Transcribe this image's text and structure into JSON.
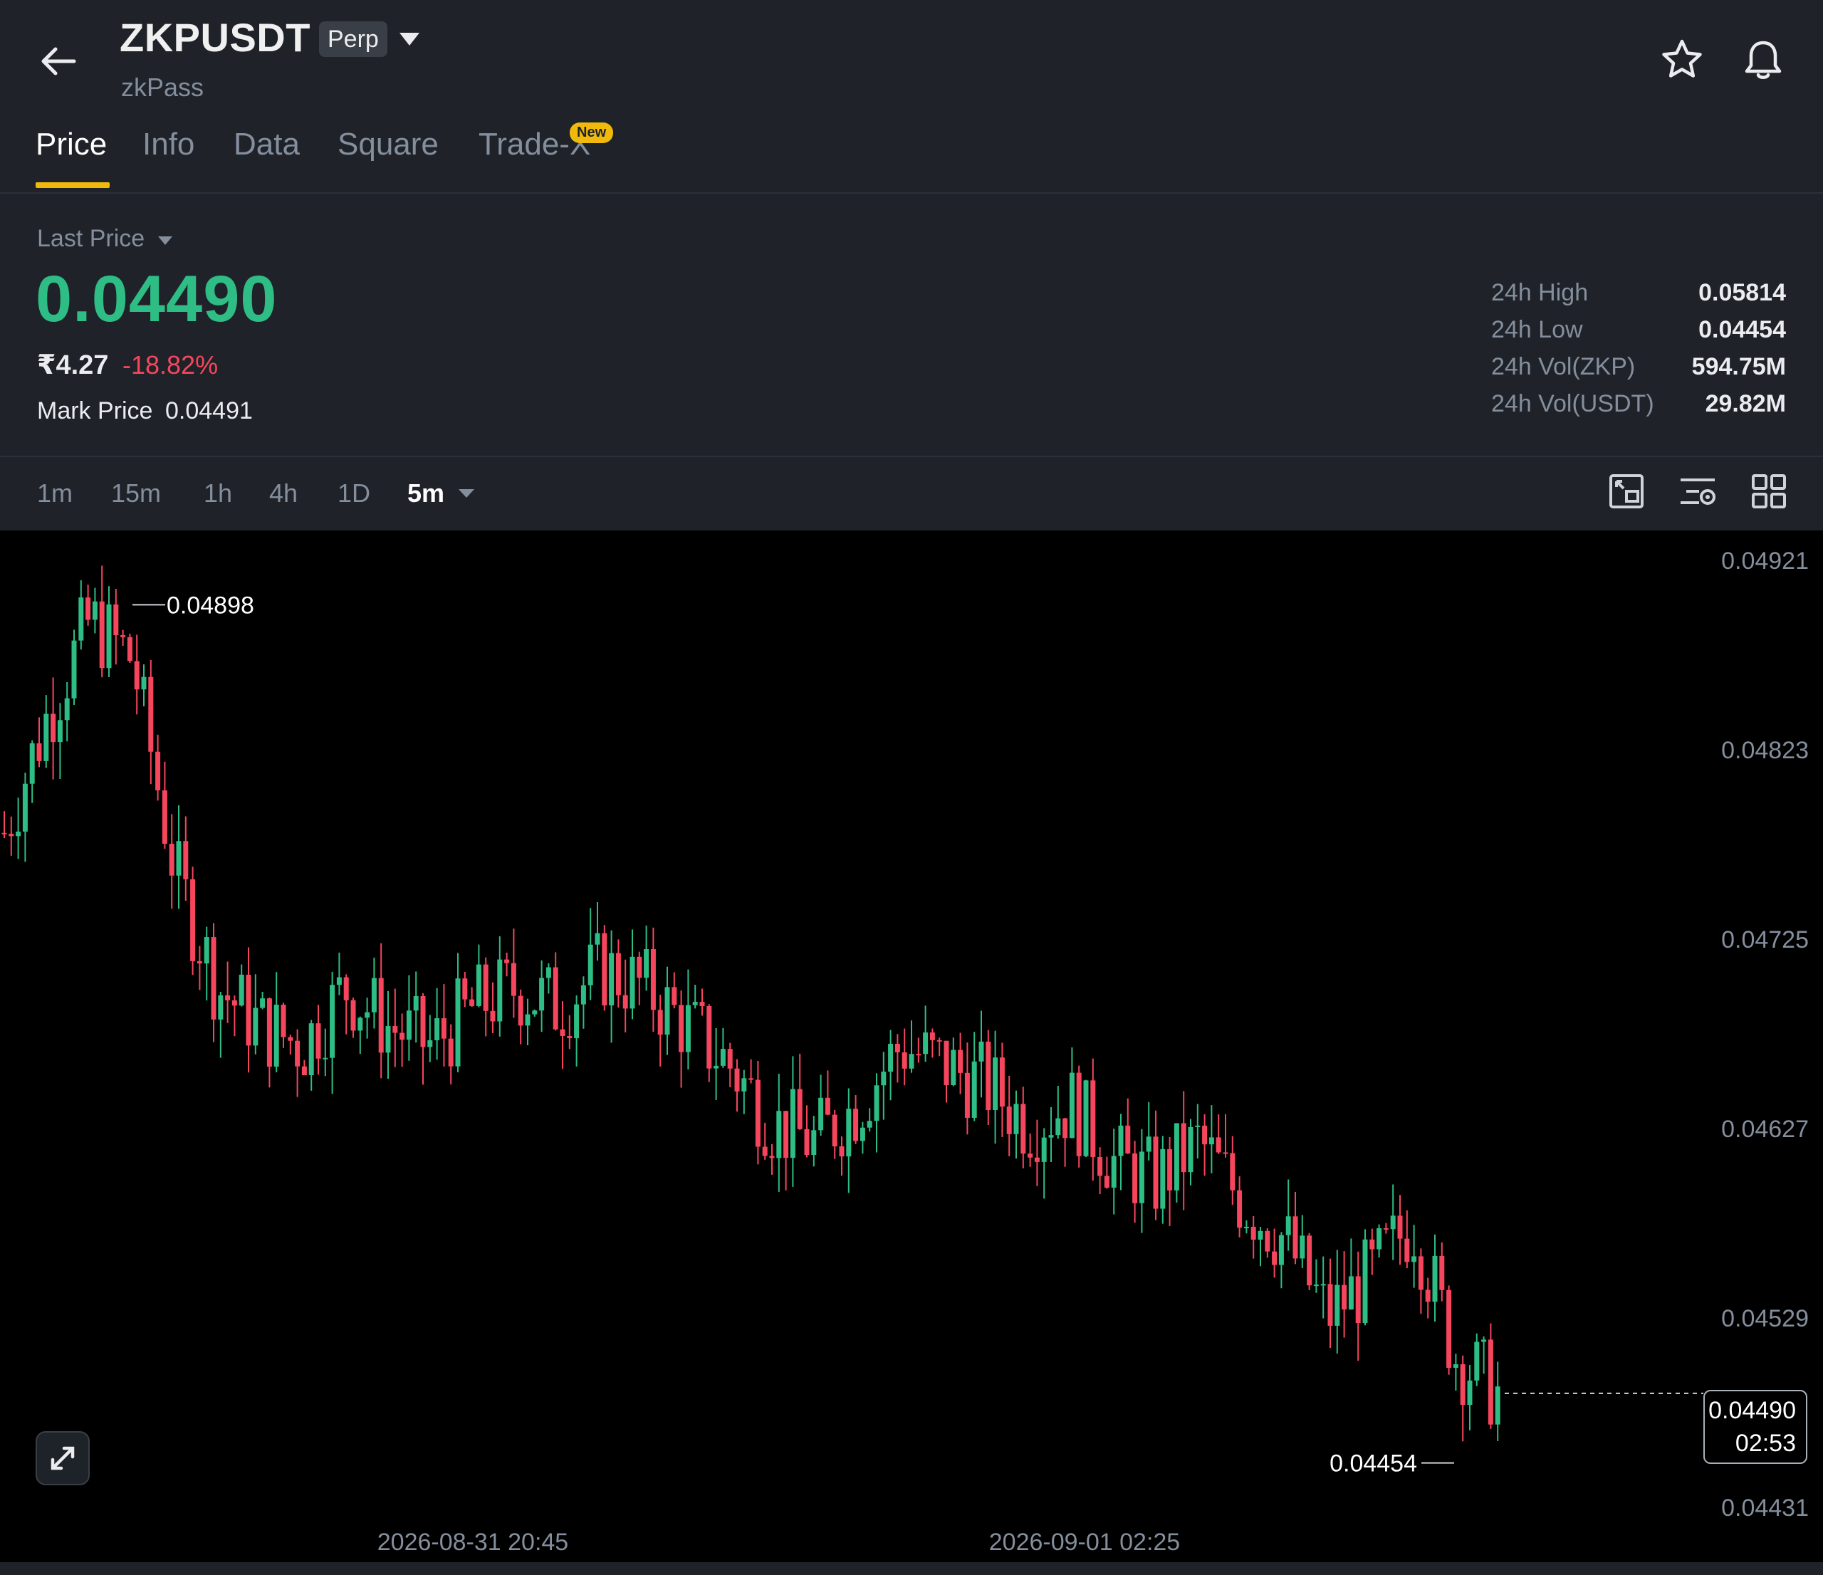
{
  "header": {
    "symbol": "ZKPUSDT",
    "badge": "Perp",
    "subtitle": "zkPass",
    "icons": [
      "back-arrow-icon",
      "chevron-down-icon",
      "star-icon",
      "bell-icon"
    ]
  },
  "tabs": [
    {
      "label": "Price",
      "active": true
    },
    {
      "label": "Info",
      "active": false
    },
    {
      "label": "Data",
      "active": false
    },
    {
      "label": "Square",
      "active": false
    },
    {
      "label": "Trade-X",
      "active": false,
      "badge": "New"
    }
  ],
  "price": {
    "label": "Last Price",
    "last": "0.04490",
    "fiat": "₹4.27",
    "change": "-18.82%",
    "mark_label": "Mark Price",
    "mark_value": "0.04491"
  },
  "stats": [
    {
      "label": "24h High",
      "value": "0.05814"
    },
    {
      "label": "24h Low",
      "value": "0.04454"
    },
    {
      "label": "24h Vol(ZKP)",
      "value": "594.75M"
    },
    {
      "label": "24h Vol(USDT)",
      "value": "29.82M"
    }
  ],
  "intervals": [
    {
      "label": "1m",
      "active": false
    },
    {
      "label": "15m",
      "active": false
    },
    {
      "label": "1h",
      "active": false
    },
    {
      "label": "4h",
      "active": false
    },
    {
      "label": "1D",
      "active": false
    },
    {
      "label": "5m",
      "active": true
    }
  ],
  "toolbar_icons": [
    "chart-settings-icon",
    "indicator-icon",
    "layout-grid-icon"
  ],
  "colors": {
    "up": "#2ebd85",
    "down": "#f6465d",
    "accent": "#f0b90b",
    "background": "#1f2329",
    "chart_bg": "#000000"
  },
  "chart_data": {
    "type": "candlestick",
    "y_ticks": [
      "0.04921",
      "0.04823",
      "0.04725",
      "0.04627",
      "0.04529",
      "0.04431"
    ],
    "ylim": [
      0.04431,
      0.04921
    ],
    "x_labels": [
      "2026-08-31 20:45",
      "2026-09-01 02:25"
    ],
    "annotations": {
      "high": "0.04898",
      "low": "0.04454"
    },
    "current_price": "0.04490",
    "countdown": "02:53",
    "waypoints_close": [
      0.0478,
      0.0484,
      0.0489,
      0.0487,
      0.0476,
      0.047,
      0.0468,
      0.0467,
      0.047,
      0.0468,
      0.0467,
      0.0469,
      0.047,
      0.0469,
      0.0471,
      0.047,
      0.0468,
      0.0466,
      0.0463,
      0.0462,
      0.0464,
      0.0467,
      0.0466,
      0.0465,
      0.0463,
      0.0464,
      0.0461,
      0.046,
      0.0462,
      0.0459,
      0.0457,
      0.0453,
      0.0455,
      0.0458,
      0.0451,
      0.0449
    ]
  }
}
